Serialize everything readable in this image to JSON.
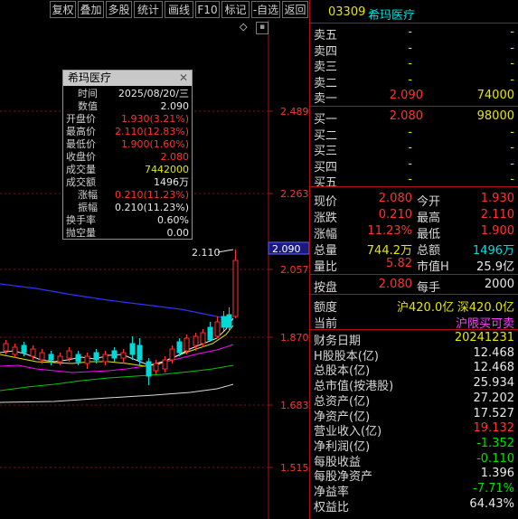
{
  "toolbar": {
    "buttons": [
      "复权",
      "叠加",
      "多股",
      "统计",
      "画线",
      "F10",
      "标记",
      "-自选",
      "返回"
    ]
  },
  "chart": {
    "price_ticks": [
      "2.489",
      "2.263",
      "2.057",
      "1.870",
      "1.683",
      "1.515"
    ],
    "current_price_tag": "2.090",
    "peak_label": "2.110",
    "diamond": "◇",
    "colors": {
      "up": "#ff3232",
      "down": "#00d8d8",
      "ma5": "#e8e8e8",
      "ma10": "#e6e600",
      "ma20": "#ff00ff",
      "ma60": "#00c800",
      "long": "#3030ff"
    }
  },
  "tooltip": {
    "title": "希玛医疗",
    "close_symbol": "✕",
    "rows": [
      {
        "k": "时间",
        "v": "2025/08/20/三",
        "c": "white"
      },
      {
        "k": "数值",
        "v": "2.090",
        "c": "white"
      },
      {
        "k": "开盘价",
        "v": "1.930(3.21%)",
        "c": "red"
      },
      {
        "k": "最高价",
        "v": "2.110(12.83%)",
        "c": "red"
      },
      {
        "k": "最低价",
        "v": "1.900(1.60%)",
        "c": "red"
      },
      {
        "k": "收盘价",
        "v": "2.080",
        "c": "red"
      },
      {
        "k": "成交量",
        "v": "7442000",
        "c": "yellow"
      },
      {
        "k": "成交额",
        "v": "1496万",
        "c": "white"
      },
      {
        "k": "涨幅",
        "v": "0.210(11.23%)",
        "c": "red"
      },
      {
        "k": "振幅",
        "v": "0.210(11.23%)",
        "c": "white"
      },
      {
        "k": "换手率",
        "v": "0.60%",
        "c": "white"
      },
      {
        "k": "抛空量",
        "v": "0.00",
        "c": "white"
      }
    ]
  },
  "stock": {
    "code": "03309",
    "name": "希玛医疗"
  },
  "order_book": {
    "asks": [
      {
        "label": "卖五",
        "price": "-",
        "volume": "-"
      },
      {
        "label": "卖四",
        "price": "-",
        "volume": "-"
      },
      {
        "label": "卖三",
        "price": "-",
        "volume": "-"
      },
      {
        "label": "卖二",
        "price": "-",
        "volume": "-"
      },
      {
        "label": "卖一",
        "price": "2.090",
        "volume": "74000"
      }
    ],
    "bids": [
      {
        "label": "买一",
        "price": "2.080",
        "volume": "98000"
      },
      {
        "label": "买二",
        "price": "-",
        "volume": "-"
      },
      {
        "label": "买三",
        "price": "-",
        "volume": "-"
      },
      {
        "label": "买四",
        "price": "-",
        "volume": "-"
      },
      {
        "label": "买五",
        "price": "-",
        "volume": "-"
      }
    ]
  },
  "quote": {
    "now_l": "现价",
    "now": "2.080",
    "open_l": "今开",
    "open": "1.930",
    "chg_l": "涨跌",
    "chg": "0.210",
    "high_l": "最高",
    "high": "2.110",
    "pct_l": "涨幅",
    "pct": "11.23%",
    "low_l": "最低",
    "low": "1.900",
    "vol_l": "总量",
    "vol": "744.2万",
    "amt_l": "总额",
    "amt": "1496万",
    "ratio_l": "量比",
    "ratio": "5.82",
    "mcap_l": "市值H",
    "mcap": "25.9亿",
    "auction_l": "按盘",
    "auction": "2.080",
    "lot_l": "每手",
    "lot": "2000",
    "quota_l": "额度",
    "quota_sh": "沪420.0亿",
    "quota_sz": "深420.0亿",
    "current_l": "当前",
    "current": "沪限买可卖"
  },
  "finance": [
    {
      "k": "财务日期",
      "v": "20241231",
      "c": "yellow"
    },
    {
      "k": "H股股本(亿)",
      "v": "12.468",
      "c": "white"
    },
    {
      "k": "总股本(亿)",
      "v": "12.468",
      "c": "white"
    },
    {
      "k": "总市值(按港股)",
      "v": "25.934",
      "c": "white"
    },
    {
      "k": "总资产(亿)",
      "v": "27.202",
      "c": "white"
    },
    {
      "k": "净资产(亿)",
      "v": "17.527",
      "c": "white"
    },
    {
      "k": "营业收入(亿)",
      "v": "19.132",
      "c": "red"
    },
    {
      "k": "净利润(亿)",
      "v": "-1.352",
      "c": "green"
    },
    {
      "k": "每股收益",
      "v": "-0.110",
      "c": "green"
    },
    {
      "k": "每股净资产",
      "v": "1.396",
      "c": "white"
    },
    {
      "k": "净益率",
      "v": "-7.71%",
      "c": "green"
    },
    {
      "k": "权益比",
      "v": "64.43%",
      "c": "white"
    }
  ]
}
